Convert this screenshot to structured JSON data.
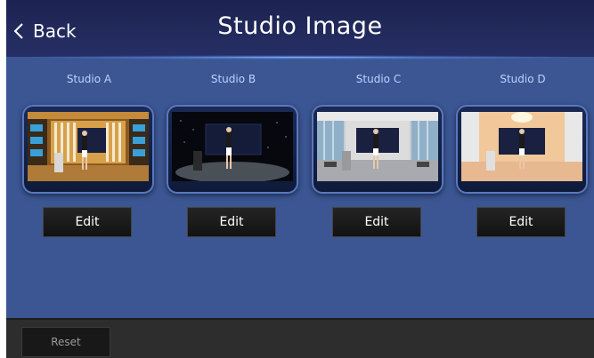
{
  "header": {
    "back_label": "Back",
    "title": "Studio Image"
  },
  "studios": [
    {
      "label": "Studio A",
      "edit_label": "Edit"
    },
    {
      "label": "Studio B",
      "edit_label": "Edit"
    },
    {
      "label": "Studio C",
      "edit_label": "Edit"
    },
    {
      "label": "Studio D",
      "edit_label": "Edit"
    }
  ],
  "footer": {
    "reset_label": "Reset"
  },
  "colors": {
    "background": "#3b5693",
    "header": "#222a5c",
    "studio_label": "#bcd2ff",
    "footer": "#2d2d2d"
  },
  "icons": {
    "back": "chevron-left-icon"
  }
}
